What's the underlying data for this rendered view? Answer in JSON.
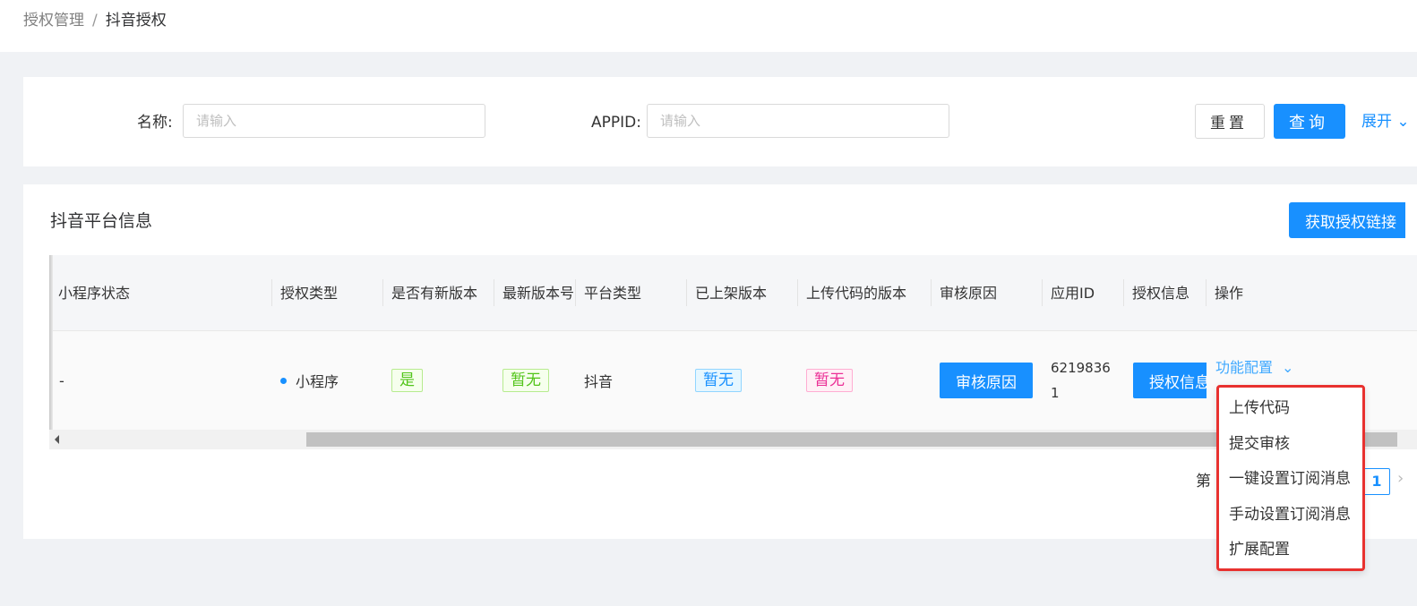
{
  "breadcrumb": {
    "parent": "授权管理",
    "separator": "/",
    "current": "抖音授权"
  },
  "search": {
    "name_label": "名称",
    "name_placeholder": "请输入",
    "appid_label": "APPID",
    "appid_placeholder": "请输入",
    "reset_label": "重置",
    "query_label": "查询",
    "expand_label": "展开"
  },
  "card": {
    "title": "抖音平台信息",
    "get_link_label": "获取授权链接"
  },
  "table": {
    "columns": [
      "小程序状态",
      "授权类型",
      "是否有新版本",
      "最新版本号",
      "平台类型",
      "已上架版本",
      "上传代码的版本",
      "审核原因",
      "应用ID",
      "授权信息",
      "操作"
    ],
    "row": {
      "status": "-",
      "auth_type": "小程序",
      "has_new_version": "是",
      "latest_version": "暂无",
      "platform": "抖音",
      "published_version": "暂无",
      "uploaded_version": "暂无",
      "review_reason_button": "审核原因",
      "app_id_line1": "6219836",
      "app_id_line2": "1",
      "auth_info_button": "授权信息",
      "action_link": "功能配置"
    }
  },
  "pagination": {
    "prefix": "第",
    "current_page": "1"
  },
  "dropdown": {
    "items": [
      "上传代码",
      "提交审核",
      "一键设置订阅消息",
      "手动设置订阅消息",
      "扩展配置"
    ],
    "highlight_color": "#e8312f"
  },
  "colors": {
    "primary": "#1890ff",
    "success": "#52c41a",
    "magenta": "#eb2f96"
  }
}
